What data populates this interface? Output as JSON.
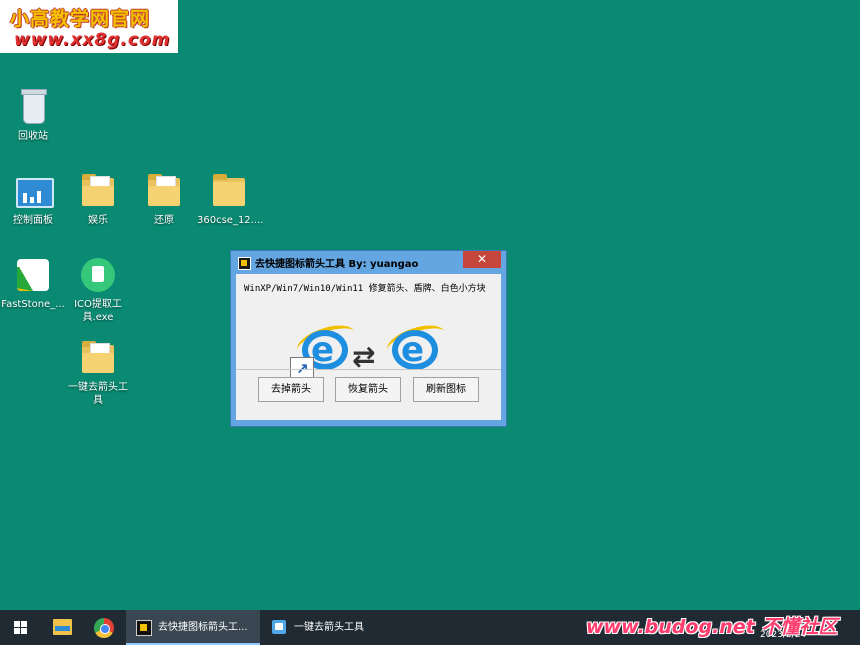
{
  "watermark_top": {
    "line1": "小高教学网官网",
    "line2": "www.xx8g.com"
  },
  "desktop_icons": [
    {
      "label": "回收站"
    },
    {
      "label": "控制面板"
    },
    {
      "label": "娱乐"
    },
    {
      "label": "还原"
    },
    {
      "label": "360cse_12...."
    },
    {
      "label": "FastStone_..."
    },
    {
      "label": "ICO提取工具.exe"
    },
    {
      "label": "一键去箭头工具"
    }
  ],
  "dialog": {
    "title": "去快捷图标箭头工具  By: yuangao",
    "close": "✕",
    "caption": "WinXP/Win7/Win10/Win11 修复箭头、盾牌、白色小方块",
    "swap_symbol": "⇄",
    "buttons": {
      "remove": "去掉箭头",
      "restore": "恢复箭头",
      "refresh": "刷新图标"
    }
  },
  "taskbar": {
    "tasks": [
      {
        "label": "去快捷图标箭头工..."
      },
      {
        "label": "一键去箭头工具"
      }
    ],
    "date": "2023/2/24"
  },
  "watermark_bottom": "www.budog.net 不懂社区",
  "colors": {
    "desktop": "#0a8a72",
    "dialog_frame": "#64a6e2",
    "close_button": "#c7463b",
    "taskbar": "#1f2a33"
  }
}
